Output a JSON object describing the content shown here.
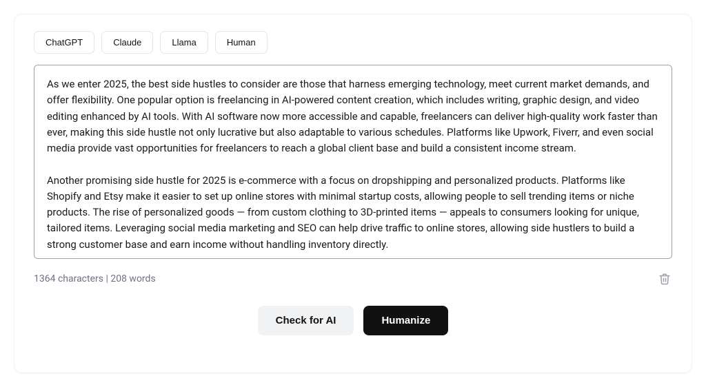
{
  "tabs": {
    "items": [
      {
        "label": "ChatGPT"
      },
      {
        "label": "Claude"
      },
      {
        "label": "Llama"
      },
      {
        "label": "Human"
      }
    ]
  },
  "editor": {
    "text": "As we enter 2025, the best side hustles to consider are those that harness emerging technology, meet current market demands, and offer flexibility. One popular option is freelancing in AI-powered content creation, which includes writing, graphic design, and video editing enhanced by AI tools. With AI software now more accessible and capable, freelancers can deliver high-quality work faster than ever, making this side hustle not only lucrative but also adaptable to various schedules. Platforms like Upwork, Fiverr, and even social media provide vast opportunities for freelancers to reach a global client base and build a consistent income stream.\n\nAnother promising side hustle for 2025 is e-commerce with a focus on dropshipping and personalized products. Platforms like Shopify and Etsy make it easier to set up online stores with minimal startup costs, allowing people to sell trending items or niche products. The rise of personalized goods — from custom clothing to 3D-printed items — appeals to consumers looking for unique, tailored items. Leveraging social media marketing and SEO can help drive traffic to online stores, allowing side hustlers to build a strong customer base and earn income without handling inventory directly."
  },
  "meta": {
    "characters": 1364,
    "words": 208,
    "label_template": "1364 characters | 208 words"
  },
  "actions": {
    "check_label": "Check for AI",
    "humanize_label": "Humanize"
  },
  "icons": {
    "trash": "trash-icon"
  }
}
